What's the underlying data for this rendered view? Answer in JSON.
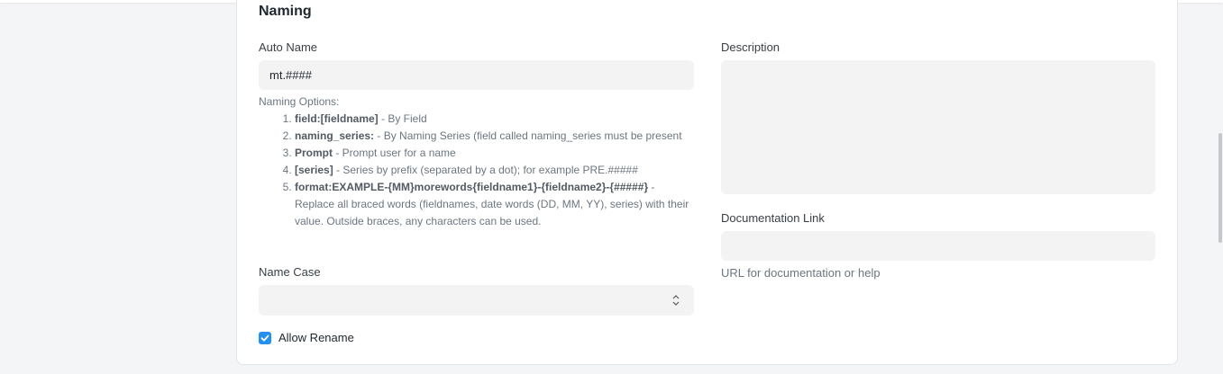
{
  "section": {
    "title": "Naming"
  },
  "auto_name": {
    "label": "Auto Name",
    "value": "mt.####"
  },
  "naming_options": {
    "heading": "Naming Options:",
    "items": [
      {
        "bold": "field:[fieldname]",
        "text": " - By Field"
      },
      {
        "bold": "naming_series:",
        "text": " - By Naming Series (field called naming_series must be present"
      },
      {
        "bold": "Prompt",
        "text": " - Prompt user for a name"
      },
      {
        "bold": "[series]",
        "text": " - Series by prefix (separated by a dot); for example PRE.#####"
      },
      {
        "bold": "format:EXAMPLE-{MM}morewords{fieldname1}-{fieldname2}-{#####}",
        "text": " - Replace all braced words (fieldnames, date words (DD, MM, YY), series) with their value. Outside braces, any characters can be used."
      }
    ]
  },
  "name_case": {
    "label": "Name Case",
    "value": ""
  },
  "allow_rename": {
    "label": "Allow Rename",
    "checked": true
  },
  "description": {
    "label": "Description",
    "value": ""
  },
  "documentation_link": {
    "label": "Documentation Link",
    "value": "",
    "help": "URL for documentation or help"
  },
  "colors": {
    "accent": "#2490ef",
    "input_bg": "#f3f3f3",
    "page_bg": "#f4f5f6"
  }
}
